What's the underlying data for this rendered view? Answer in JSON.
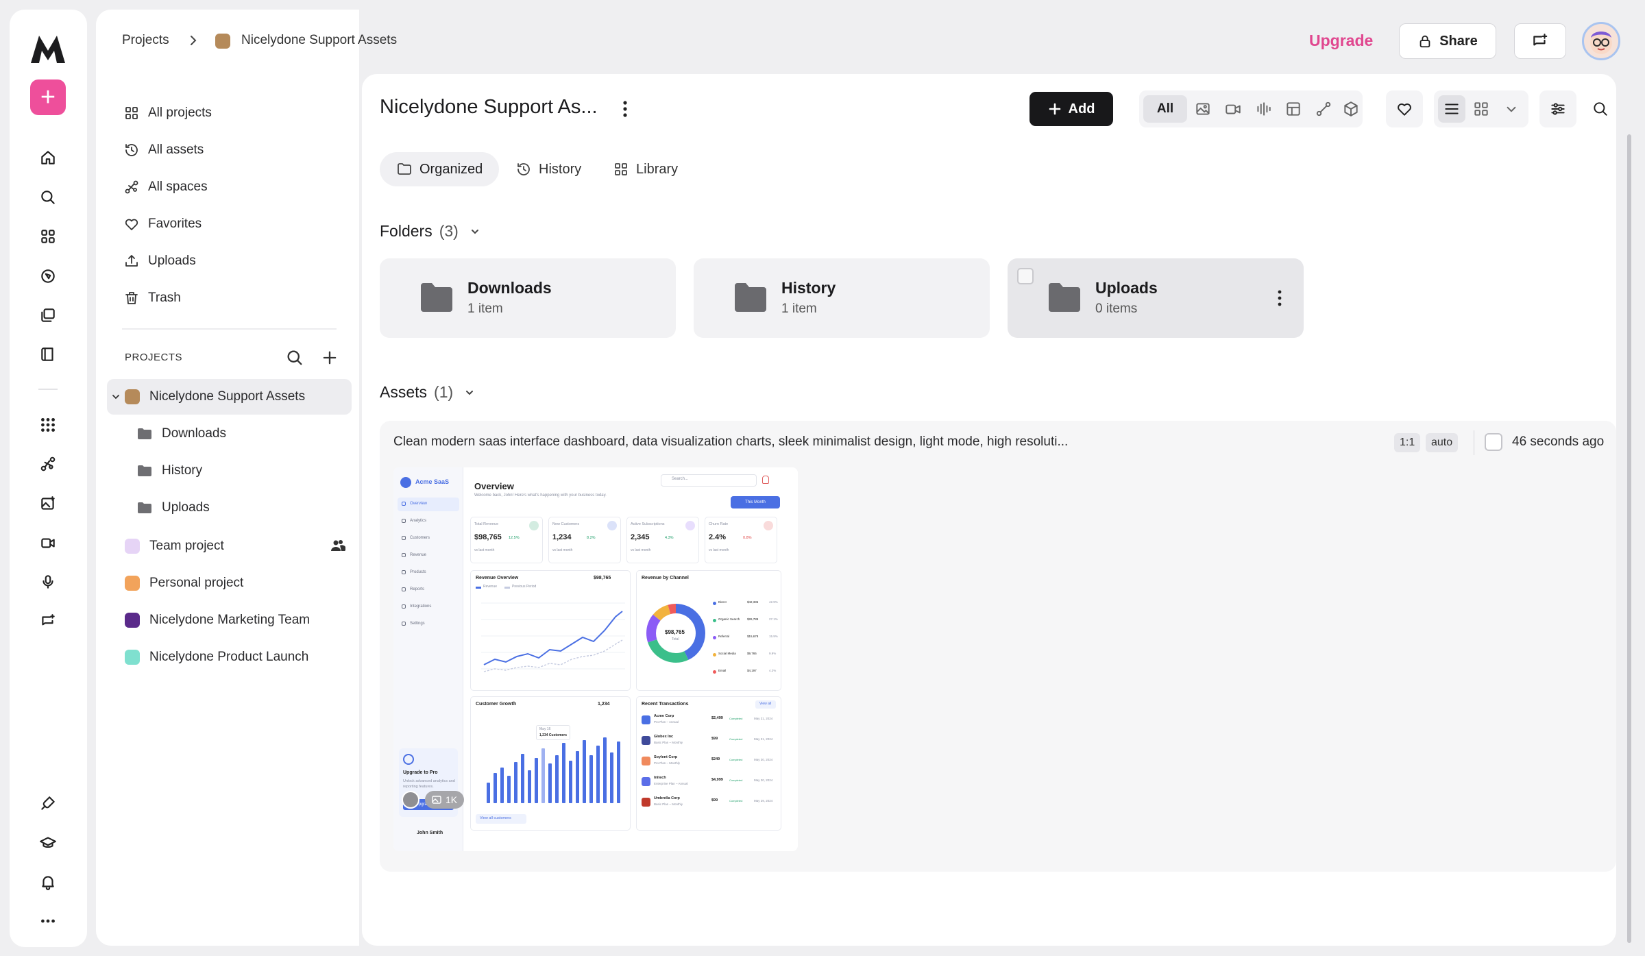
{
  "breadcrumb": {
    "root": "Projects",
    "current": "Nicelydone Support Assets"
  },
  "topbar": {
    "upgrade": "Upgrade",
    "share": "Share"
  },
  "sidebar": {
    "nav": [
      {
        "label": "All projects",
        "icon": "grid-icon"
      },
      {
        "label": "All assets",
        "icon": "history-icon"
      },
      {
        "label": "All spaces",
        "icon": "spaces-icon"
      },
      {
        "label": "Favorites",
        "icon": "heart-icon"
      },
      {
        "label": "Uploads",
        "icon": "upload-icon"
      },
      {
        "label": "Trash",
        "icon": "trash-icon"
      }
    ],
    "projects_heading": "PROJECTS",
    "projects": [
      {
        "label": "Nicelydone Support Assets",
        "color": "#b58a5a"
      },
      {
        "label": "Team project",
        "color": "#e6d4f6"
      },
      {
        "label": "Personal project",
        "color": "#f2a35b"
      },
      {
        "label": "Nicelydone Marketing Team",
        "color": "#5a2a8a"
      },
      {
        "label": "Nicelydone Product Launch",
        "color": "#7fe0cf"
      }
    ],
    "subfolders": [
      "Downloads",
      "History",
      "Uploads"
    ]
  },
  "main": {
    "title": "Nicelydone Support As...",
    "add_label": "Add",
    "filter_all": "All",
    "tabs": [
      "Organized",
      "History",
      "Library"
    ],
    "folders_label": "Folders",
    "folders_count": "(3)",
    "folders": [
      {
        "name": "Downloads",
        "count": "1 item"
      },
      {
        "name": "History",
        "count": "1 item"
      },
      {
        "name": "Uploads",
        "count": "0 items"
      }
    ],
    "assets_label": "Assets",
    "assets_count": "(1)",
    "asset": {
      "prompt": "Clean modern saas interface dashboard, data visualization charts, sleek minimalist design, light mode, high resoluti...",
      "ratio": "1:1",
      "mode": "auto",
      "time": "46 seconds ago",
      "resolution": "1K"
    }
  },
  "thumbnail": {
    "brand": "Acme SaaS",
    "nav": [
      "Overview",
      "Analytics",
      "Customers",
      "Revenue",
      "Products",
      "Reports",
      "Integrations",
      "Settings"
    ],
    "heading": "Overview",
    "subheading": "Welcome back, John! Here's what's happening with your business today.",
    "search": "Search...",
    "period": "This Month",
    "kpis": [
      {
        "label": "Total Revenue",
        "value": "$98,765",
        "delta": "12.5%"
      },
      {
        "label": "New Customers",
        "value": "1,234",
        "delta": "8.2%"
      },
      {
        "label": "Active Subscriptions",
        "value": "2,345",
        "delta": "4.3%"
      },
      {
        "label": "Churn Rate",
        "value": "2.4%",
        "delta": "0.8%"
      }
    ],
    "vs_label": "vs last month",
    "revenue_title": "Revenue Overview",
    "revenue_value": "$98,765",
    "revenue_legend": [
      "Revenue",
      "Previous Period"
    ],
    "channel_title": "Revenue by Channel",
    "channel_total": "$98,765",
    "channel_total_label": "Total",
    "channels": [
      {
        "name": "Direct",
        "value": "$42,336",
        "pct": "42.9%",
        "color": "#4a6fe3"
      },
      {
        "name": "Organic Search",
        "value": "$26,789",
        "pct": "27.1%",
        "color": "#3bbf8a"
      },
      {
        "name": "Referral",
        "value": "$15,678",
        "pct": "15.9%",
        "color": "#8b5cf6"
      },
      {
        "name": "Social Media",
        "value": "$9,765",
        "pct": "9.9%",
        "color": "#f2b33d"
      },
      {
        "name": "Email",
        "value": "$4,197",
        "pct": "4.2%",
        "color": "#ef5b5b"
      }
    ],
    "growth_title": "Customer Growth",
    "growth_value": "1,234",
    "growth_tooltip_date": "May 16",
    "growth_tooltip_value": "1,234 Customers",
    "view_customers": "View all customers",
    "tx_title": "Recent Transactions",
    "tx_view": "View all",
    "transactions": [
      {
        "name": "Acme Corp",
        "plan": "Pro Plan – Annual",
        "amount": "$2,499",
        "status": "Completed",
        "date": "May 31, 2024",
        "color": "#4a6fe3"
      },
      {
        "name": "Globex Inc",
        "plan": "Basic Plan – Monthly",
        "amount": "$99",
        "status": "Completed",
        "date": "May 31, 2024",
        "color": "#3f4a9a"
      },
      {
        "name": "Soylent Corp",
        "plan": "Pro Plan – Monthly",
        "amount": "$249",
        "status": "Completed",
        "date": "May 30, 2024",
        "color": "#f08a5d"
      },
      {
        "name": "Initech",
        "plan": "Enterprise Plan – Annual",
        "amount": "$4,999",
        "status": "Completed",
        "date": "May 30, 2024",
        "color": "#5b6ee8"
      },
      {
        "name": "Umbrella Corp",
        "plan": "Basic Plan – Monthly",
        "amount": "$99",
        "status": "Completed",
        "date": "May 29, 2024",
        "color": "#c0392b"
      }
    ],
    "promo_title": "Upgrade to Pro",
    "promo_text": "Unlock advanced analytics and reporting features.",
    "promo_button": "Upgrade Now",
    "user": "John Smith"
  }
}
